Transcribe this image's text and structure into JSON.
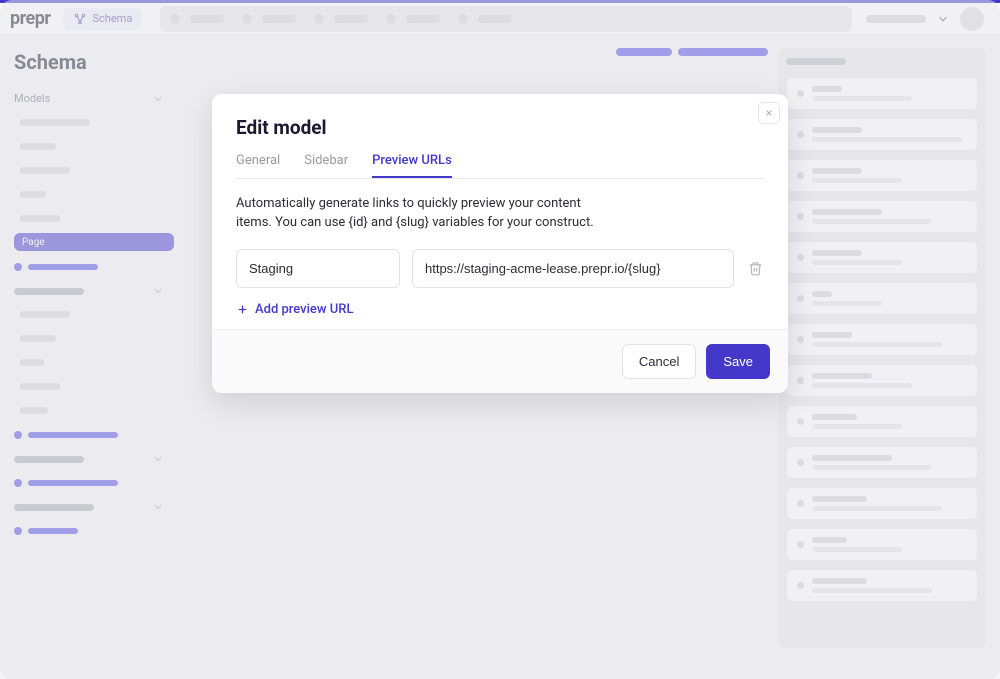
{
  "header": {
    "logo": "prepr",
    "schema_chip": "Schema"
  },
  "sidebar": {
    "title": "Schema",
    "models_label": "Models",
    "selected_item": "Page"
  },
  "modal": {
    "title": "Edit model",
    "tabs": {
      "general": "General",
      "sidebar": "Sidebar",
      "preview": "Preview URLs"
    },
    "description": "Automatically generate links to quickly preview your content items. You can use {id} and {slug} variables for your construct.",
    "row": {
      "name_value": "Staging",
      "url_value": "https://staging-acme-lease.prepr.io/{slug}"
    },
    "add_label": "Add preview URL",
    "cancel": "Cancel",
    "save": "Save"
  }
}
